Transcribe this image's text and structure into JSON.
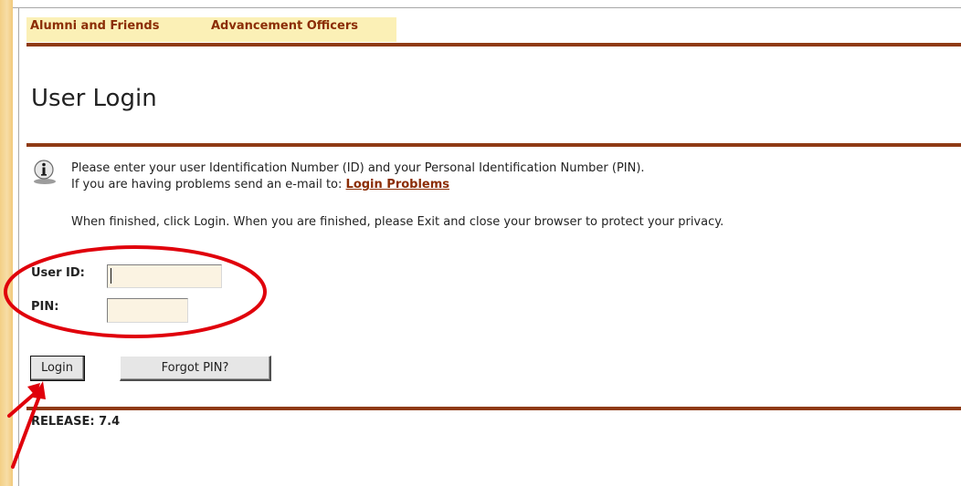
{
  "nav": {
    "items": [
      {
        "label": "Alumni and Friends"
      },
      {
        "label": "Advancement Officers"
      }
    ]
  },
  "page": {
    "title": "User Login"
  },
  "info": {
    "icon": "info-icon",
    "line1": "Please enter your user Identification Number (ID) and your Personal Identification Number (PIN).",
    "line2_prefix": "If you are having problems send an e-mail to:",
    "help_link": "Login Problems",
    "line3": "When finished, click Login. When you are finished, please Exit and close your browser to protect your privacy."
  },
  "form": {
    "user_id_label": "User ID:",
    "user_id_value": "",
    "pin_label": "PIN:",
    "pin_value": ""
  },
  "buttons": {
    "login": "Login",
    "forgot_pin": "Forgot PIN?"
  },
  "footer": {
    "release": "RELEASE: 7.4"
  },
  "colors": {
    "accent_brown": "#8b2d05",
    "rule": "#8f3a14",
    "nav_bg": "#fbf0b6",
    "field_bg": "#fbf3e2",
    "annotation_red": "#e0000b"
  }
}
